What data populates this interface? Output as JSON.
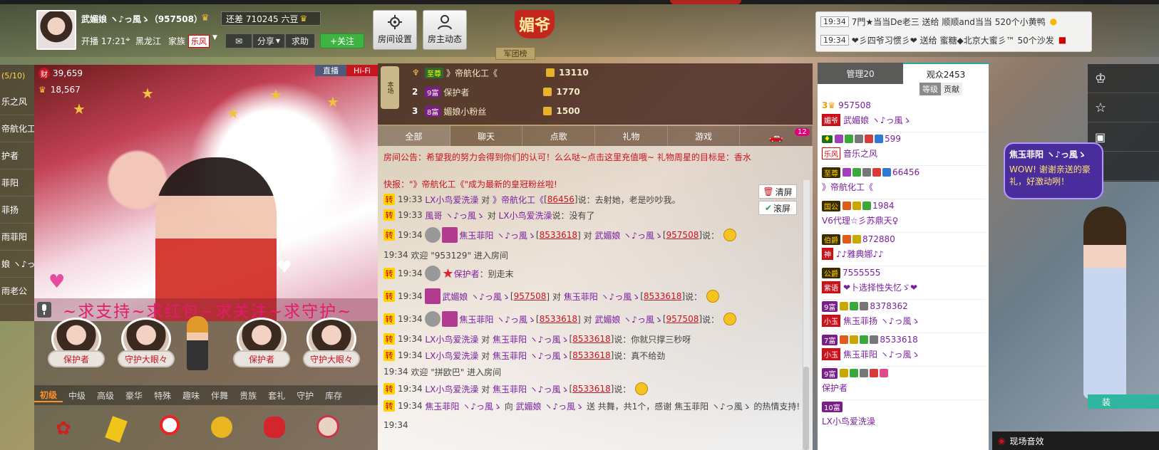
{
  "header": {
    "streamer_name": "武媚娘 ヽ♪っ風ゝ（957508）",
    "gap_text": "还差 710245 六豆",
    "start_time": "开播 17:21",
    "location": "黑龙江",
    "family_label": "家族",
    "family_badge": "乐风",
    "share_label": "分享",
    "help_label": "求助",
    "follow_label": "+关注",
    "room_settings": "房间设置",
    "host_activity": "房主动态",
    "meiye_title": "媚爷",
    "army_label": "军团榜"
  },
  "gift_feed": [
    {
      "time": "19:34",
      "text": "7門★当当De老三 送给 顺顺and当当 520个小黄鸭"
    },
    {
      "time": "19:34",
      "text": "❤彡四爷习惯彡❤ 送给 蜜糖◆北京大蜜彡™ 50个沙发"
    }
  ],
  "video": {
    "fortune": "39,659",
    "fans": "18,567",
    "mode_live": "直播",
    "mode_hifi": "Hi-Fi",
    "marquee": "~求支持~求红包~求关注~求守护~"
  },
  "left_list": {
    "counter": "(5/10)",
    "items": [
      "乐之风",
      "帝航化工",
      "护者",
      "菲阳",
      "菲扬",
      "雨菲阳",
      "娘 ヽ♪っ",
      "雨老公"
    ]
  },
  "guards": [
    {
      "label": "保护者"
    },
    {
      "label": "守护大眼々"
    },
    {
      "label": "保护者"
    },
    {
      "label": "守护大眼々"
    }
  ],
  "gift_tabs": [
    "初级",
    "中级",
    "高级",
    "豪华",
    "特殊",
    "趣味",
    "伴舞",
    "贵族",
    "套礼",
    "守护",
    "库存"
  ],
  "rank": [
    {
      "num": "1",
      "badge": "至尊",
      "name": "》帝航化工《",
      "value": "13110"
    },
    {
      "num": "2",
      "badge": "9富",
      "name": "保护者",
      "value": "1770"
    },
    {
      "num": "3",
      "badge": "8富",
      "name": "媚娘小粉丝",
      "value": "1500"
    }
  ],
  "chat_tabs": [
    "全部",
    "聊天",
    "点歌",
    "礼物",
    "游戏",
    ""
  ],
  "car_count": "12",
  "chat": {
    "notice": "房间公告：希望我的努力会得到你们的认可！么么哒~点击这里充值哦~  礼物周星的目标是：香水",
    "fast_news": "快报：\"》帝航化工《\"成为最新的皇冠粉丝啦!",
    "clear_label": "清屏",
    "scroll_label": "滚屏",
    "lines": [
      {
        "time": "19:33",
        "from": "LX小鸟爱洗澡",
        "to": "》帝航化工《",
        "to_id": "86456",
        "msg": "说：去射她，老是吵吵我。"
      },
      {
        "time": "19:33",
        "from": "風哥 ヽ♪っ風ゝ",
        "to": "LX小鸟爱洗澡",
        "to_id": "",
        "msg": "说：没有了"
      },
      {
        "time": "19:34",
        "from": "焦玉菲阳 ヽ♪っ風ゝ",
        "from_id": "8533618",
        "to": "武媚娘 ヽ♪っ風ゝ",
        "to_id": "957508",
        "msg": "说："
      },
      {
        "time": "19:34",
        "sys": "欢迎 \"953129\" 进入房间"
      },
      {
        "time": "19:34",
        "from": "保护者",
        "msg": "：别走末"
      },
      {
        "time": "19:34",
        "from": "武媚娘 ヽ♪っ風ゝ",
        "from_id": "957508",
        "to": "焦玉菲阳 ヽ♪っ風ゝ",
        "to_id": "8533618",
        "msg": "说："
      },
      {
        "time": "19:34",
        "from": "焦玉菲阳 ヽ♪っ風ゝ",
        "from_id": "8533618",
        "to": "武媚娘 ヽ♪っ風ゝ",
        "to_id": "957508",
        "msg": "说："
      },
      {
        "time": "19:34",
        "from": "LX小鸟爱洗澡",
        "to": "焦玉菲阳 ヽ♪っ風ゝ",
        "to_id": "8533618",
        "msg": "说：你就只撑三秒呀"
      },
      {
        "time": "19:34",
        "from": "LX小鸟爱洗澡",
        "to": "焦玉菲阳 ヽ♪っ風ゝ",
        "to_id": "8533618",
        "msg": "说：真不给劲"
      },
      {
        "time": "19:34",
        "sys": "欢迎 \"拼欧巴\" 进入房间"
      },
      {
        "time": "19:34",
        "from": "LX小鸟爱洗澡",
        "to": "焦玉菲阳 ヽ♪っ風ゝ",
        "to_id": "8533618",
        "msg": "说："
      },
      {
        "time": "19:34",
        "from": "焦玉菲阳 ヽ♪っ風ゝ",
        "to": "武媚娘 ヽ♪っ風ゝ",
        "msg": "送 共舞，共1个，感谢 焦玉菲阳 ヽ♪っ風ゝ 的热情支持!"
      },
      {
        "time": "19:34",
        "sys": ""
      }
    ]
  },
  "users": {
    "tab_admin": "管理20",
    "tab_audience": "观众2453",
    "level_btn": "等级",
    "contrib_btn": "贡献",
    "list": [
      {
        "id": "957508",
        "fan": "媚爷",
        "name": "武媚娘 ヽ♪っ風ゝ"
      },
      {
        "id": "599",
        "fan": "乐风",
        "name": "音乐之风"
      },
      {
        "id": "66456",
        "fan": "",
        "name": "》帝航化工《"
      },
      {
        "id": "1984",
        "fan": "",
        "name": "V6代理☆彡苏鼎天♀"
      },
      {
        "id": "872880",
        "fan": "神",
        "name": "♪♪雅典娜♪♪"
      },
      {
        "id": "7555555",
        "fan": "紫语",
        "name": "❤卜选择性失忆ゞ❤"
      },
      {
        "id": "8378362",
        "fan": "小玉",
        "name": "焦玉菲扬 ヽ♪っ風ゝ"
      },
      {
        "id": "8533618",
        "fan": "小玉",
        "name": "焦玉菲阳 ヽ♪っ風ゝ"
      },
      {
        "id": "",
        "fan": "",
        "name": "保护者"
      },
      {
        "id": "",
        "fan": "",
        "name": "LX小鸟爱洗澡"
      }
    ]
  },
  "side": {
    "bubble_name": "焦玉菲阳 ヽ♪っ風ゝ",
    "bubble_msg": "WOW! 谢谢亲送的豪礼，好激动咧！",
    "fx_label": "现场音效",
    "install_label": "装"
  },
  "colors": {
    "accent_red": "#c8141f",
    "follow_green": "#3fb33f",
    "teal": "#2aa7a0"
  }
}
